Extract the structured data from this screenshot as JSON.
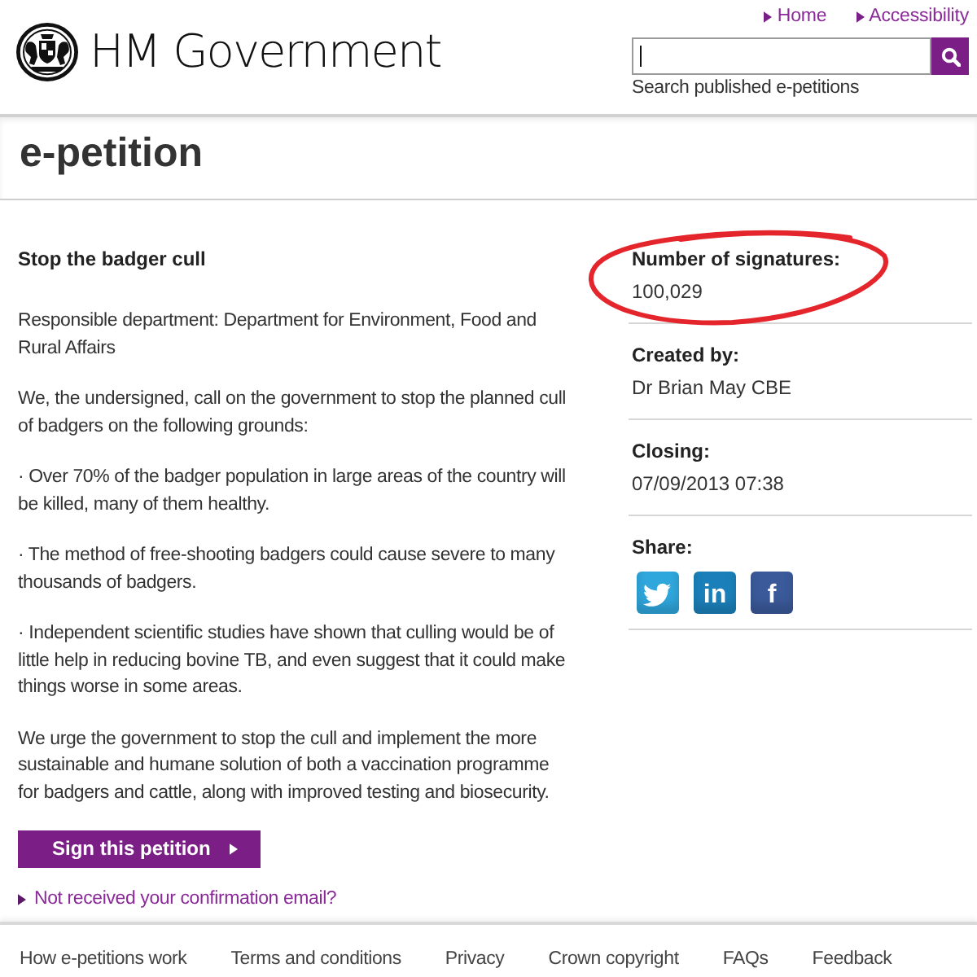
{
  "header": {
    "logo": "HM Government",
    "links": [
      {
        "label": "Home"
      },
      {
        "label": "Accessibility"
      }
    ],
    "search": {
      "focused": true,
      "hint": "Search published e-petitions"
    }
  },
  "page_title": "e-petition",
  "petition": {
    "title": "Stop the badger cull",
    "paragraphs": [
      "Responsible department: Department for Environment, Food and Rural Affairs",
      "We, the undersigned, call on the government to stop the planned cull of badgers on the following grounds:",
      "· Over 70% of the badger population in large areas of the country will be killed, many of them healthy.",
      "· The method of free-shooting badgers could cause severe to many thousands of badgers.",
      "· Independent scientific studies have shown that culling would be of little help in reducing bovine TB, and even suggest that it could make things worse in some areas.",
      "We urge the government to stop the cull and implement the more sustainable and humane solution of both a vaccination programme for badgers and cattle, along with improved testing and biosecurity."
    ],
    "sign_button": "Sign this petition",
    "confirmation_link": "Not received your confirmation email?"
  },
  "details": [
    {
      "label": "Number of signatures:",
      "value": "100,029",
      "circled": true
    },
    {
      "label": "Created by:",
      "value": "Dr Brian May CBE",
      "circled": false
    },
    {
      "label": "Closing:",
      "value": "07/09/2013 07:38",
      "circled": false
    }
  ],
  "share": {
    "label": "Share:",
    "buttons": [
      {
        "kind": "bird",
        "color": "#2fa6dc"
      },
      {
        "kind": "letters",
        "text": "in",
        "color": "#1b80ba"
      },
      {
        "kind": "letters",
        "text": "f",
        "color": "#3b5a9a"
      }
    ]
  },
  "footer": {
    "links": [
      "How e-petitions work",
      "Terms and conditions",
      "Privacy",
      "Crown copyright",
      "FAQs",
      "Feedback"
    ]
  }
}
